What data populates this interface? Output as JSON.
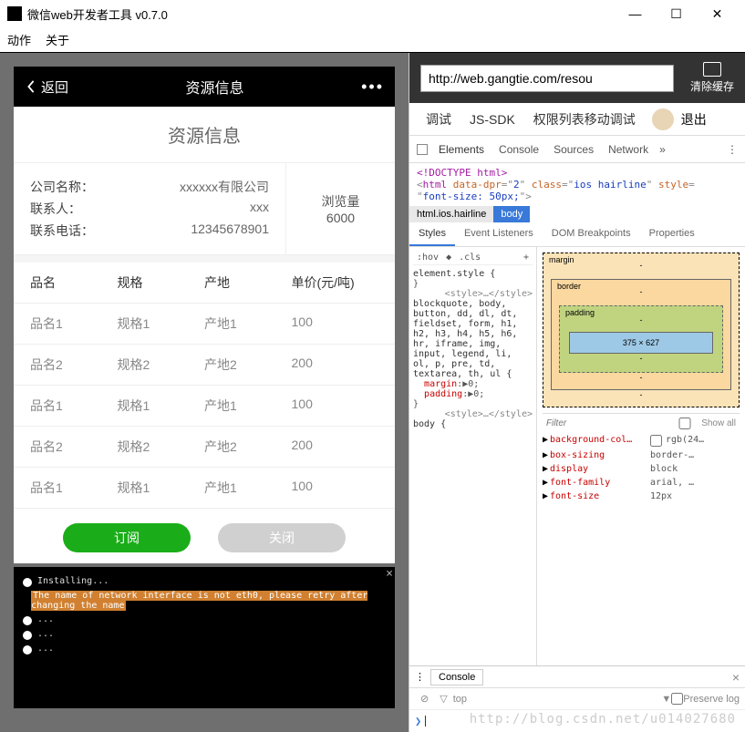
{
  "window": {
    "title": "微信web开发者工具 v0.7.0"
  },
  "menu": {
    "action": "动作",
    "about": "关于"
  },
  "phone": {
    "back": "返回",
    "nav_title": "资源信息",
    "page_title": "资源信息",
    "company_lbl": "公司名称：",
    "company_val": "xxxxxx有限公司",
    "contact_lbl": "联系人：",
    "contact_val": "xxx",
    "phone_lbl": "联系电话：",
    "phone_val": "12345678901",
    "views_lbl": "浏览量",
    "views_val": "6000",
    "head": {
      "c1": "品名",
      "c2": "规格",
      "c3": "产地",
      "c4": "单价(元/吨)"
    },
    "rows": [
      {
        "c1": "品名1",
        "c2": "规格1",
        "c3": "产地1",
        "c4": "100"
      },
      {
        "c1": "品名2",
        "c2": "规格2",
        "c3": "产地2",
        "c4": "200"
      },
      {
        "c1": "品名1",
        "c2": "规格1",
        "c3": "产地1",
        "c4": "100"
      },
      {
        "c1": "品名2",
        "c2": "规格2",
        "c3": "产地2",
        "c4": "200"
      },
      {
        "c1": "品名1",
        "c2": "规格1",
        "c3": "产地1",
        "c4": "100"
      }
    ],
    "btn_sub": "订阅",
    "btn_close": "关闭"
  },
  "console_log": {
    "line1": "Installing...",
    "line2_hl": "The name of network interface is not eth0, please retry after changing the name",
    "line3": "...",
    "line4": "..."
  },
  "url": "http://web.gangtie.com/resou",
  "clear_cache": "清除缓存",
  "devtool_tabs": {
    "debug": "调试",
    "sdk": "JS-SDK",
    "perm": "权限列表",
    "mobile": "移动调试",
    "exit": "退出"
  },
  "panels": {
    "elements": "Elements",
    "console": "Console",
    "sources": "Sources",
    "network": "Network"
  },
  "dom": {
    "doctype": "<!DOCTYPE html>",
    "dpr": "2",
    "cls": "ios hairline",
    "font": "font-size: 50px;"
  },
  "crumbs": {
    "c1": "html.ios.hairline",
    "c2": "body"
  },
  "style_tabs": {
    "s": "Styles",
    "el": "Event Listeners",
    "db": "DOM Breakpoints",
    "pr": "Properties"
  },
  "style_panel": {
    "hov": ":hov",
    "cls": ".cls",
    "el_style": "element.style {",
    "rule_sel": "blockquote, body, button, dd, dl, dt, fieldset, form, h1, h2, h3, h4, h5, h6, hr, iframe, img, input, legend, li, ol, p, pre, td, textarea, th, ul {",
    "margin": "margin",
    "padding": "padding",
    "zero": "0",
    "body_rule": "body {",
    "style_tag": "<style>…</style>"
  },
  "box": {
    "margin": "margin",
    "border": "border",
    "padding": "padding",
    "content": "375 × 627",
    "dash": "-"
  },
  "filter": {
    "ph": "Filter",
    "show_all": "Show all"
  },
  "computed": [
    {
      "p": "background-col…",
      "v": "rgb(24…",
      "cb": true
    },
    {
      "p": "box-sizing",
      "v": "border-…"
    },
    {
      "p": "display",
      "v": "block"
    },
    {
      "p": "font-family",
      "v": "arial, …"
    },
    {
      "p": "font-size",
      "v": "12px"
    }
  ],
  "bottom": {
    "console": "Console",
    "top": "top",
    "preserve": "Preserve log",
    "prompt": "❯"
  },
  "watermark": "http://blog.csdn.net/u014027680"
}
